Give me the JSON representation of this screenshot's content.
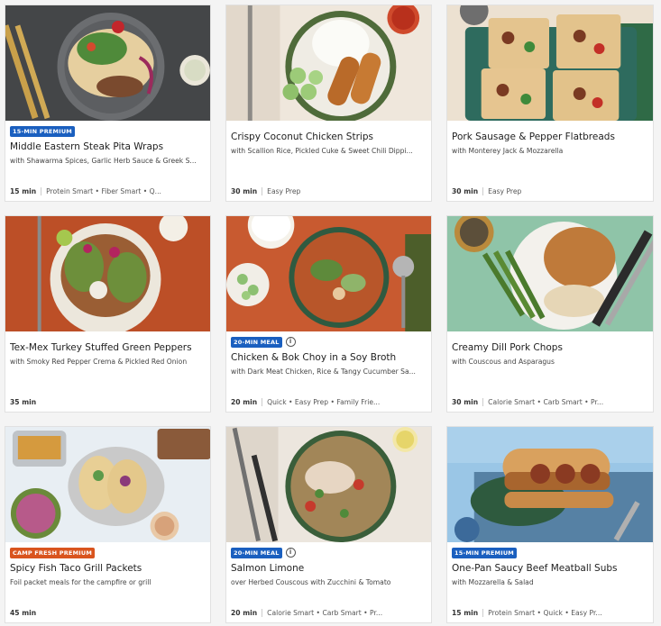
{
  "colors": {
    "badge_blue": "#1a5fbf",
    "badge_orange": "#d9541e"
  },
  "recipes": [
    {
      "badge": "15-MIN PREMIUM",
      "badge_color": "blue",
      "title": "Middle Eastern Steak Pita Wraps",
      "subtitle": "with Shawarma Spices, Garlic Herb Sauce & Greek S...",
      "time": "15 min",
      "tags": "Protein Smart • Fiber Smart • Q..."
    },
    {
      "badge": "",
      "title": "Crispy Coconut Chicken Strips",
      "subtitle": "with Scallion Rice, Pickled Cuke & Sweet Chili Dippi...",
      "time": "30 min",
      "tags": "Easy Prep"
    },
    {
      "badge": "",
      "title": "Pork Sausage & Pepper Flatbreads",
      "subtitle": "with Monterey Jack & Mozzarella",
      "time": "30 min",
      "tags": "Easy Prep"
    },
    {
      "badge": "",
      "title": "Tex-Mex Turkey Stuffed Green Peppers",
      "subtitle": "with Smoky Red Pepper Crema & Pickled Red Onion",
      "time": "35 min",
      "tags": ""
    },
    {
      "badge": "20-MIN MEAL",
      "badge_color": "blue",
      "info": "i",
      "title": "Chicken & Bok Choy in a Soy Broth",
      "subtitle": "with Dark Meat Chicken, Rice & Tangy Cucumber Sa...",
      "time": "20 min",
      "tags": "Quick • Easy Prep • Family Frie..."
    },
    {
      "badge": "",
      "title": "Creamy Dill Pork Chops",
      "subtitle": "with Couscous and Asparagus",
      "time": "30 min",
      "tags": "Calorie Smart • Carb Smart • Pr..."
    },
    {
      "badge": "CAMP FRESH PREMIUM",
      "badge_color": "orange",
      "title": "Spicy Fish Taco Grill Packets",
      "subtitle": "Foil packet meals for the campfire or grill",
      "time": "45 min",
      "tags": ""
    },
    {
      "badge": "20-MIN MEAL",
      "badge_color": "blue",
      "info": "i",
      "title": "Salmon Limone",
      "subtitle": "over Herbed Couscous with Zucchini & Tomato",
      "time": "20 min",
      "tags": "Calorie Smart • Carb Smart • Pr..."
    },
    {
      "badge": "15-MIN PREMIUM",
      "badge_color": "blue",
      "title": "One-Pan Saucy Beef Meatball Subs",
      "subtitle": "with Mozzarella & Salad",
      "time": "15 min",
      "tags": "Protein Smart • Quick • Easy Pr..."
    }
  ]
}
